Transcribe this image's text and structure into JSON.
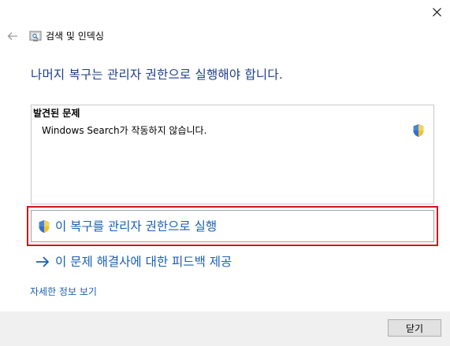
{
  "window": {
    "title": "검색 및 인덱싱",
    "close_icon": "close-icon",
    "back_icon": "back-arrow-icon",
    "app_icon": "troubleshooter-icon"
  },
  "main": {
    "heading": "나머지 복구는 관리자 권한으로 실행해야 합니다.",
    "problems": {
      "header": "발견된 문제",
      "items": [
        {
          "label": "Windows Search가 작동하지 않습니다.",
          "icon": "uac-shield-icon"
        }
      ]
    },
    "run_admin": {
      "label": "이 복구를 관리자 권한으로 실행",
      "icon": "uac-shield-icon"
    },
    "feedback": {
      "label": "이 문제 해결사에 대한 피드백 제공",
      "icon": "arrow-right-icon"
    },
    "details_link": "자세한 정보 보기"
  },
  "footer": {
    "close_button_label": "닫기"
  },
  "colors": {
    "heading": "#1c3d8c",
    "link": "#1a5fb4",
    "highlight_outline": "#d0121b",
    "footer_bg": "#f0f0f0"
  }
}
